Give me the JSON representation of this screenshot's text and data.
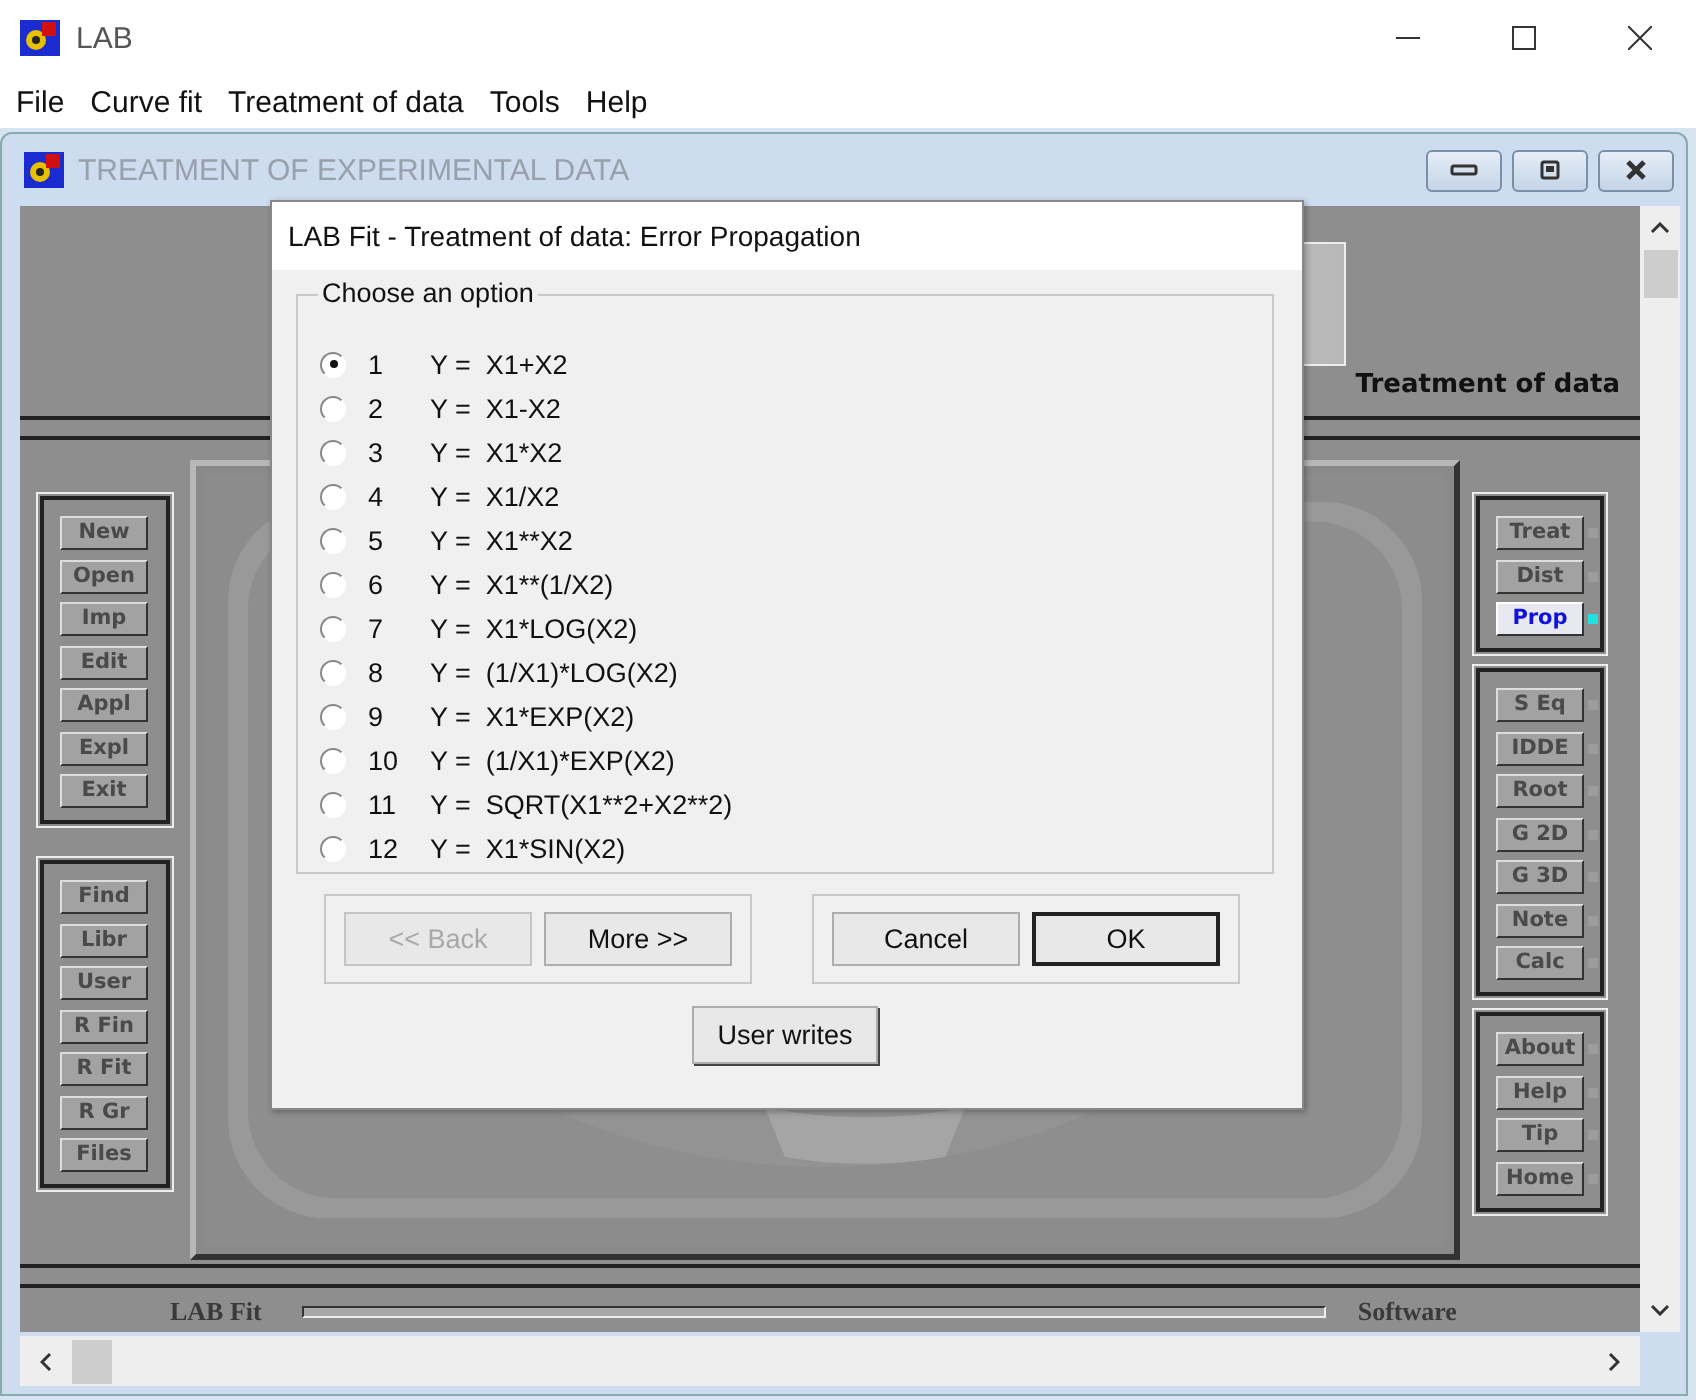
{
  "app": {
    "title": "LAB"
  },
  "menu": [
    {
      "label": "File"
    },
    {
      "label": "Curve fit"
    },
    {
      "label": "Treatment of data"
    },
    {
      "label": "Tools"
    },
    {
      "label": "Help"
    }
  ],
  "child": {
    "title": "TREATMENT OF EXPERIMENTAL DATA",
    "section_label": "Treatment of data",
    "left_groups": [
      [
        {
          "label": "New"
        },
        {
          "label": "Open"
        },
        {
          "label": "Imp"
        },
        {
          "label": "Edit"
        },
        {
          "label": "Appl"
        },
        {
          "label": "Expl"
        },
        {
          "label": "Exit"
        }
      ],
      [
        {
          "label": "Find"
        },
        {
          "label": "Libr"
        },
        {
          "label": "User"
        },
        {
          "label": "R Fin"
        },
        {
          "label": "R Fit"
        },
        {
          "label": "R Gr"
        },
        {
          "label": "Files"
        }
      ]
    ],
    "right_groups": [
      [
        {
          "label": "Treat",
          "active": false
        },
        {
          "label": "Dist",
          "active": false
        },
        {
          "label": "Prop",
          "active": true
        }
      ],
      [
        {
          "label": "S Eq",
          "active": false
        },
        {
          "label": "IDDE",
          "active": false
        },
        {
          "label": "Root",
          "active": false
        },
        {
          "label": "G 2D",
          "active": false
        },
        {
          "label": "G 3D",
          "active": false
        },
        {
          "label": "Note",
          "active": false
        },
        {
          "label": "Calc",
          "active": false
        }
      ],
      [
        {
          "label": "About",
          "active": false
        },
        {
          "label": "Help",
          "active": false
        },
        {
          "label": "Tip",
          "active": false
        },
        {
          "label": "Home",
          "active": false
        }
      ]
    ],
    "footer_left": "LAB Fit",
    "footer_right": "Software"
  },
  "dialog": {
    "title": "LAB Fit - Treatment of data: Error Propagation",
    "group_label": "Choose an option",
    "options": [
      {
        "number": "1",
        "formula": "Y =  X1+X2",
        "selected": true
      },
      {
        "number": "2",
        "formula": "Y =  X1-X2",
        "selected": false
      },
      {
        "number": "3",
        "formula": "Y =  X1*X2",
        "selected": false
      },
      {
        "number": "4",
        "formula": "Y =  X1/X2",
        "selected": false
      },
      {
        "number": "5",
        "formula": "Y =  X1**X2",
        "selected": false
      },
      {
        "number": "6",
        "formula": "Y =  X1**(1/X2)",
        "selected": false
      },
      {
        "number": "7",
        "formula": "Y =  X1*LOG(X2)",
        "selected": false
      },
      {
        "number": "8",
        "formula": "Y =  (1/X1)*LOG(X2)",
        "selected": false
      },
      {
        "number": "9",
        "formula": "Y =  X1*EXP(X2)",
        "selected": false
      },
      {
        "number": "10",
        "formula": "Y =  (1/X1)*EXP(X2)",
        "selected": false
      },
      {
        "number": "11",
        "formula": "Y =  SQRT(X1**2+X2**2)",
        "selected": false
      },
      {
        "number": "12",
        "formula": "Y =  X1*SIN(X2)",
        "selected": false
      }
    ],
    "nav_buttons": [
      {
        "label": "<< Back",
        "disabled": true,
        "default": false
      },
      {
        "label": "More >>",
        "disabled": false,
        "default": false
      }
    ],
    "action_buttons": [
      {
        "label": "Cancel",
        "disabled": false,
        "default": false
      },
      {
        "label": "OK",
        "disabled": false,
        "default": true
      }
    ],
    "extra_button": {
      "label": "User writes",
      "disabled": false,
      "default": false
    }
  }
}
